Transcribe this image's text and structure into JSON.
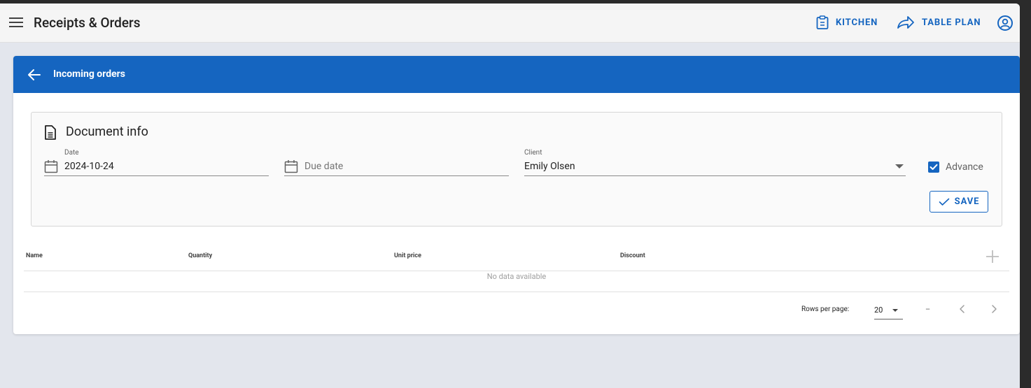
{
  "topbar": {
    "title": "Receipts & Orders",
    "menu_icon": "hamburger-menu-icon",
    "actions": [
      {
        "label": "KITCHEN",
        "icon": "clipboard-list-icon"
      },
      {
        "label": "TABLE PLAN",
        "icon": "share-arrow-icon"
      }
    ],
    "user_icon": "account-circle-icon"
  },
  "card": {
    "title": "Incoming orders",
    "back_icon": "arrow-left-icon"
  },
  "document_info": {
    "title": "Document info",
    "icon": "document-icon",
    "date": {
      "label": "Date",
      "value": "2024-10-24"
    },
    "due_date": {
      "placeholder": "Due date"
    },
    "client": {
      "label": "Client",
      "value": "Emily Olsen"
    },
    "advance": {
      "label": "Advance",
      "checked": true
    },
    "save_label": "SAVE"
  },
  "table": {
    "columns": [
      "Name",
      "Quantity",
      "Unit price",
      "Discount"
    ],
    "rows": [],
    "empty_text": "No data available",
    "add_icon": "plus-icon"
  },
  "pagination": {
    "rows_per_page_label": "Rows per page:",
    "rows_per_page": "20",
    "range_text": "–"
  },
  "colors": {
    "primary": "#1565c0",
    "background": "#e3e6ed",
    "topbar": "#f5f5f5"
  }
}
